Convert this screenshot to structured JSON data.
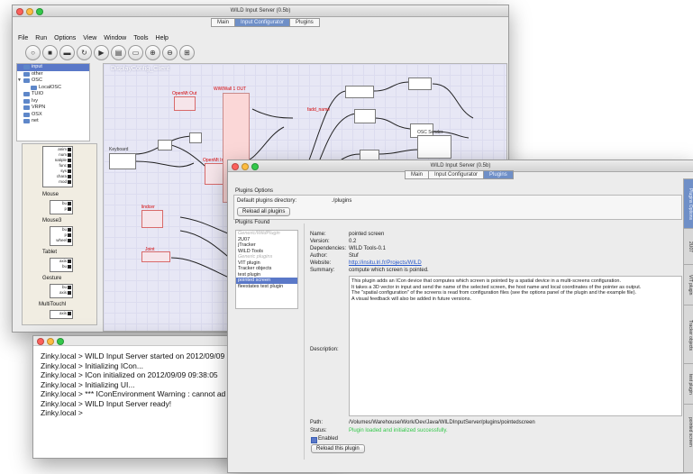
{
  "main_window": {
    "title": "WILD Input Server (0.5b)",
    "tabs": [
      "Main",
      "Input Configurator",
      "Plugins"
    ],
    "active_tab": "Input Configurator",
    "menu": [
      "File",
      "Run",
      "Options",
      "View",
      "Window",
      "Tools",
      "Help"
    ],
    "toolbar": [
      "new-icon",
      "stop-icon",
      "save-icon",
      "reload-icon",
      "play-icon",
      "pause-icon",
      "select-icon",
      "zoom-in-icon",
      "zoom-out-icon",
      "fit-icon"
    ],
    "tree": [
      {
        "label": "input",
        "selected": true
      },
      {
        "label": "other"
      },
      {
        "label": "OSC",
        "expanded": true
      },
      {
        "label": "LocalOSC"
      },
      {
        "label": "TUIO"
      },
      {
        "label": "Ivy"
      },
      {
        "label": "VRPN"
      },
      {
        "label": "OSX"
      },
      {
        "label": "net"
      }
    ],
    "palette": {
      "partial_rows": [
        "anim",
        "num",
        "natiple",
        "func",
        "sys",
        "chara",
        "mod"
      ],
      "sections": [
        {
          "label": "Mouse",
          "rows": [
            "bu",
            "p"
          ]
        },
        {
          "label": "Mouse3",
          "rows": [
            "bu",
            "p",
            "wheel"
          ]
        },
        {
          "label": "Tablet",
          "rows": [
            "axis",
            "bu"
          ]
        },
        {
          "label": "Gesture",
          "rows": [
            "bu",
            "axis"
          ]
        },
        {
          "label": "MultiTouchI",
          "rows": [
            "axis"
          ]
        }
      ]
    },
    "canvas_title": "DisplayConfig_Client",
    "node_labels": {
      "keyboard": "Keyboard",
      "openmt_out": "OpenMt Out",
      "openmt_in": "OpenMt In",
      "wildwall": "WiWWall 1 OUT",
      "osc_sender": "OSC Sender",
      "lindcer": "lindcer",
      "joint": "Joint",
      "fadd_name": "fadd_name"
    }
  },
  "plugins_window": {
    "title": "WILD Input Server (0.5b)",
    "tabs": [
      "Main",
      "Input Configurator",
      "Plugins"
    ],
    "active_tab": "Plugins",
    "options_title": "Plugins Options",
    "default_dir_label": "Default plugins directory:",
    "default_dir_value": "./plugins",
    "reload_all_label": "Reload all plugins",
    "found_title": "Plugins Found",
    "plugin_list": [
      {
        "label": "Generic/WildPlugin",
        "category": true
      },
      {
        "label": "2U07"
      },
      {
        "label": "jTracker"
      },
      {
        "label": "WILD Tools"
      },
      {
        "label": "Generic plugins",
        "category": true
      },
      {
        "label": "VIT plugin"
      },
      {
        "label": "Tracker objects"
      },
      {
        "label": "test plugin"
      },
      {
        "label": "pointed screen",
        "selected": true
      },
      {
        "label": "fleestates test plugin"
      }
    ],
    "details": {
      "name_label": "Name:",
      "name": "pointed screen",
      "version_label": "Version:",
      "version": "0.2",
      "dependencies_label": "Dependencies:",
      "dependencies": "WILD Tools-0.1",
      "author_label": "Author:",
      "author": "Stuf",
      "website_label": "Website:",
      "website": "http://insitu.lri.fr/Projects/WILD",
      "summary_label": "Summary:",
      "summary": "compute which screen is pointed.",
      "description_label": "Description:",
      "description_lines": [
        "This plugin adds an ICon device that computes which screen is pointed by a spatial device in a multi-screens configuration.",
        "It takes a 3D vector in input and send the name of the selected screen, the host name and local coordinates of the pointer as output.",
        "The \"spatial configuration\" of the screens is read from configuration files (see the options panel of the plugin and the example file).",
        "A visual feedback will also be added in future versions."
      ],
      "path_label": "Path:",
      "path": "/Volumes/Warehouse/Work/Dev/Java/WILDInputServer/plugins/pointedscreen",
      "status_label": "Status:",
      "status": "Plugin loaded and initialized successfully.",
      "enabled_label": "Enabled",
      "reload_label": "Reload this plugin"
    },
    "side_tabs": [
      "Plugins Options",
      "2U07",
      "VIT plugin",
      "Tracker objects",
      "test plugin",
      "pointed screen"
    ],
    "status_color": "#34c84a",
    "accent": "#5a78c8"
  },
  "console_window": {
    "lines": [
      "Zinky.local > WILD Input Server started on 2012/09/09",
      "Zinky.local > Initializing ICon...",
      "Zinky.local > ICon initialized on 2012/09/09 09:38:05",
      "Zinky.local > Initializing UI...",
      "Zinky.local > *** IConEnvironment Warning : cannot ad",
      "Zinky.local > WILD Input Server ready!",
      "Zinky.local >"
    ]
  }
}
